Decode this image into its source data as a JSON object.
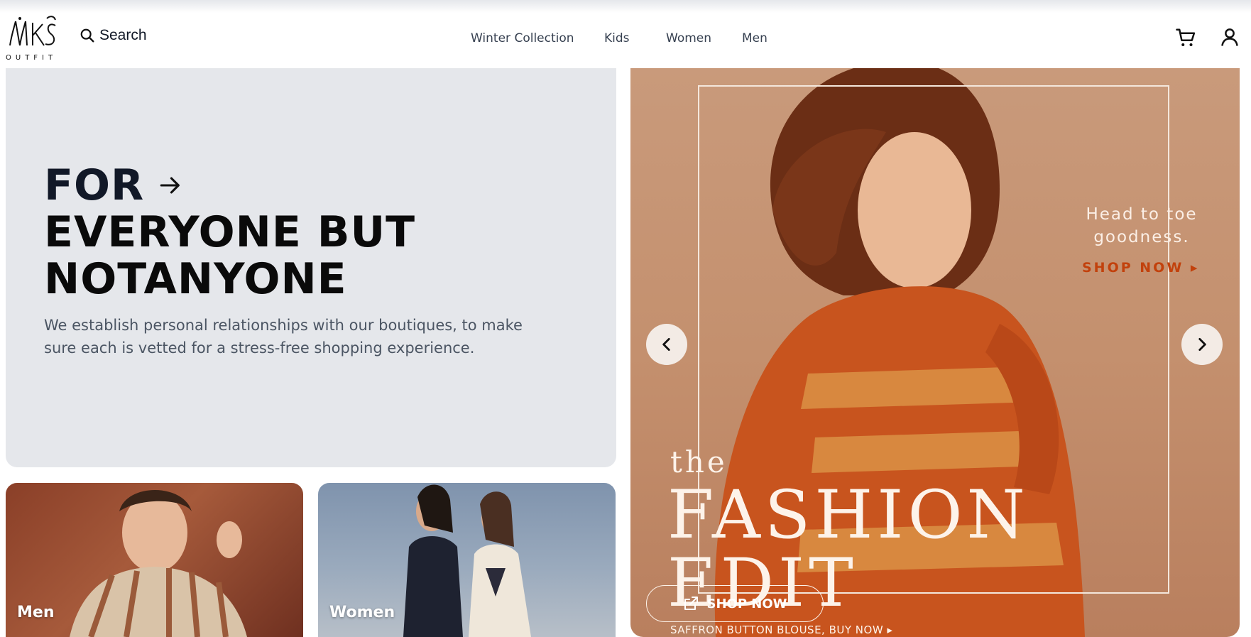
{
  "brand": {
    "logo_text": "MKS",
    "logo_sub": "OUTFIT"
  },
  "header": {
    "search_label": "Search",
    "nav": [
      "Winter Collection",
      "Kids",
      "Women",
      "Men"
    ]
  },
  "icons": {
    "search": "search-icon",
    "cart": "cart-icon",
    "user": "user-icon",
    "arrow": "arrow-right-icon",
    "prev": "chevron-left-icon",
    "next": "chevron-right-icon",
    "external": "external-link-icon"
  },
  "hero": {
    "line1": "FOR",
    "line2": "EVERYONE BUT",
    "line3": "NOTANYONE",
    "description": "We establish personal relationships with our boutiques, to make sure each is vetted for a stress-free shopping experience."
  },
  "cards": [
    {
      "label": "Men"
    },
    {
      "label": "Women"
    }
  ],
  "carousel": {
    "promo_line1": "Head to toe",
    "promo_line2": "goodness.",
    "promo_cta": "SHOP NOW ▸",
    "the_word": "the",
    "big_line1": "FASHION",
    "big_line2": "EDIT",
    "caption": "SAFFRON BUTTON BLOUSE, BUY NOW ▸",
    "shop_button": "SHOP NOW"
  },
  "colors": {
    "hero_bg": "#e5e7eb",
    "promo_cta": "#c2410c",
    "carousel_bg": "#c4906e"
  }
}
